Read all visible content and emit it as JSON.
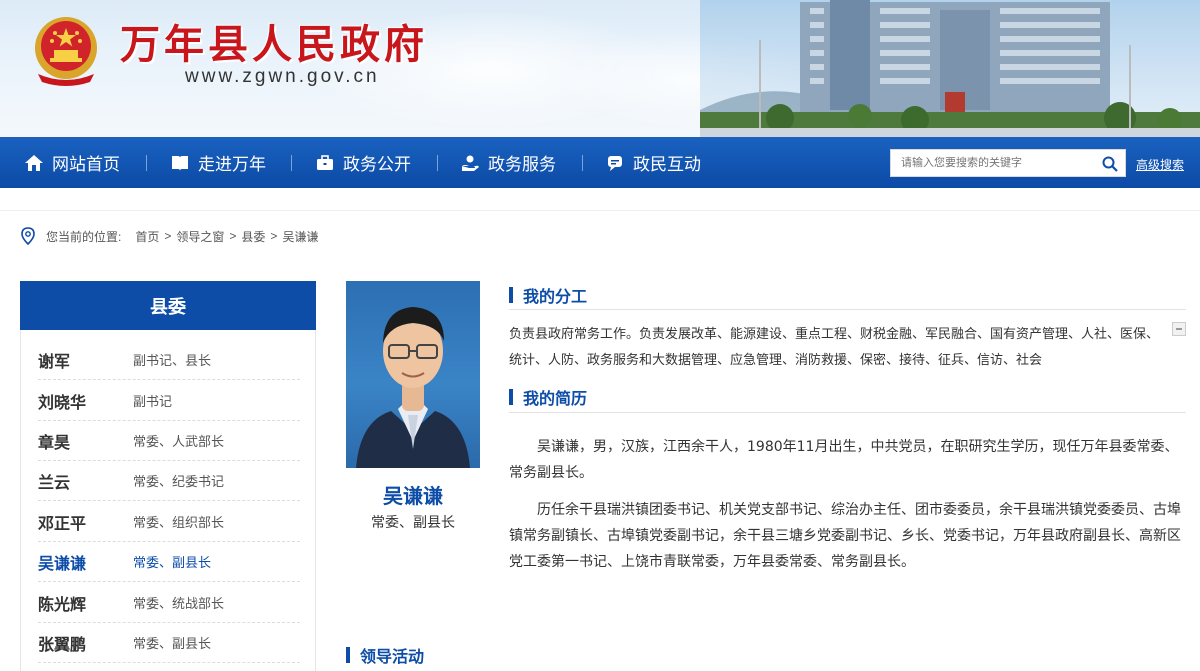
{
  "header": {
    "site_title": "万年县人民政府",
    "site_url": "www.zgwn.gov.cn"
  },
  "nav": {
    "items": [
      {
        "label": "网站首页",
        "icon": "home-icon"
      },
      {
        "label": "走进万年",
        "icon": "book-icon"
      },
      {
        "label": "政务公开",
        "icon": "briefcase-icon"
      },
      {
        "label": "政务服务",
        "icon": "hand-service-icon"
      },
      {
        "label": "政民互动",
        "icon": "chat-icon"
      }
    ],
    "search_placeholder": "请输入您要搜索的关键字",
    "advanced_search": "高级搜索"
  },
  "breadcrumb": {
    "prefix": "您当前的位置:",
    "items": [
      "首页",
      "领导之窗",
      "县委",
      "吴谦谦"
    ],
    "separator": ">"
  },
  "sidebar": {
    "heading": "县委",
    "leaders": [
      {
        "name": "谢军",
        "title": "副书记、县长"
      },
      {
        "name": "刘晓华",
        "title": "副书记"
      },
      {
        "name": "章昊",
        "title": "常委、人武部长"
      },
      {
        "name": "兰云",
        "title": "常委、纪委书记"
      },
      {
        "name": "邓正平",
        "title": "常委、组织部长"
      },
      {
        "name": "吴谦谦",
        "title": "常委、副县长",
        "active": true
      },
      {
        "name": "陈光辉",
        "title": "常委、统战部长"
      },
      {
        "name": "张翼鹏",
        "title": "常委、副县长"
      }
    ]
  },
  "profile": {
    "name": "吴谦谦",
    "title": "常委、副县长"
  },
  "duties": {
    "heading": "我的分工",
    "text": "负责县政府常务工作。负责发展改革、能源建设、重点工程、财税金融、军民融合、国有资产管理、人社、医保、统计、人防、政务服务和大数据管理、应急管理、消防救援、保密、接待、征兵、信访、社会"
  },
  "resume": {
    "heading": "我的简历",
    "para1": "吴谦谦，男，汉族，江西余干人，1980年11月出生，中共党员，在职研究生学历，现任万年县委常委、常务副县长。",
    "para2": "历任余干县瑞洪镇团委书记、机关党支部书记、综治办主任、团市委委员，余干县瑞洪镇党委委员、古埠镇常务副镇长、古埠镇党委副书记，余干县三塘乡党委副书记、乡长、党委书记，万年县政府副县长、高新区党工委第一书记、上饶市青联常委，万年县委常委、常务副县长。"
  },
  "activities": {
    "heading": "领导活动"
  },
  "colors": {
    "brand_blue": "#0d4da8",
    "title_red": "#c8161d"
  }
}
